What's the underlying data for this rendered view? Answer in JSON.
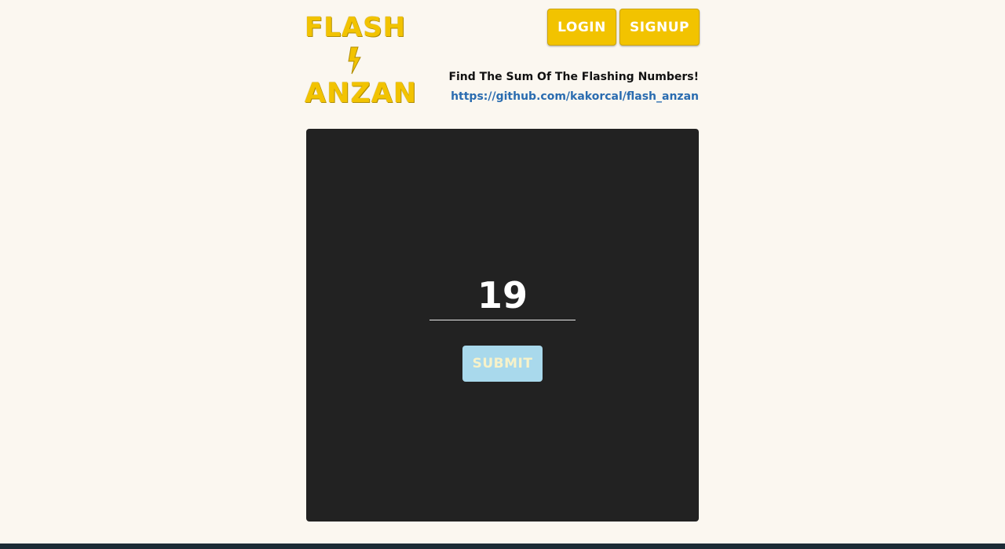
{
  "header": {
    "logo": {
      "line1": "FLASH",
      "icon": "lightning-bolt-icon",
      "line3": "ANZAN"
    },
    "buttons": {
      "login_label": "LOGIN",
      "signup_label": "SIGNUP"
    },
    "tagline": "Find The Sum Of The Flashing Numbers!",
    "repo_link": "https://github.com/kakorcal/flash_anzan"
  },
  "game": {
    "answer_value": "19",
    "submit_label": "SUBMIT"
  },
  "colors": {
    "brand_yellow": "#f2c300",
    "background": "#fbf7f0",
    "board": "#222222",
    "submit_bg": "#a9d9ec",
    "link": "#2a6cb0"
  }
}
